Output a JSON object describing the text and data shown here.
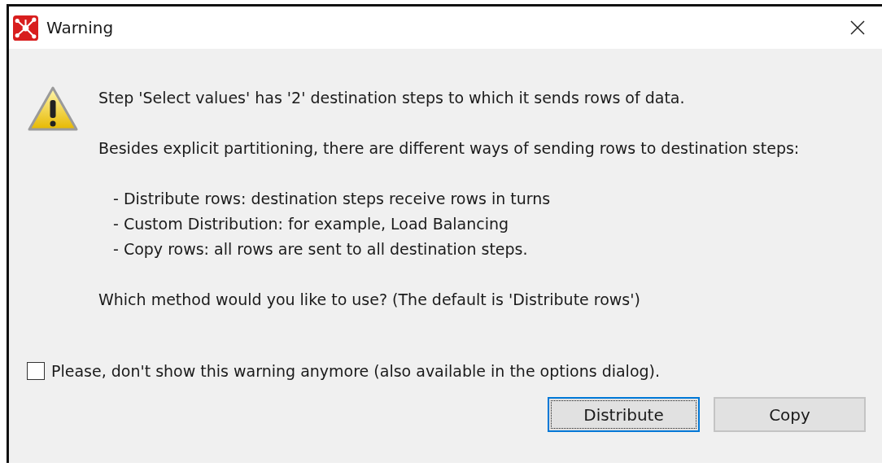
{
  "window": {
    "title": "Warning"
  },
  "message": {
    "intro": "Step 'Select values' has '2' destination steps to which it sends rows of data.",
    "explanation": "Besides explicit partitioning, there are different ways of sending rows to destination steps:",
    "options": [
      "- Distribute rows: destination steps receive rows in turns",
      "- Custom Distribution: for example,  Load Balancing",
      "- Copy rows: all rows are sent to all destination steps."
    ],
    "question": "Which method would you like to use? (The default is 'Distribute rows')"
  },
  "dont_show_again": {
    "label": "Please, don't show this warning anymore (also available in the options dialog).",
    "checked": false
  },
  "buttons": [
    {
      "label": "Distribute",
      "focused": true
    },
    {
      "label": "Copy",
      "focused": false
    }
  ]
}
